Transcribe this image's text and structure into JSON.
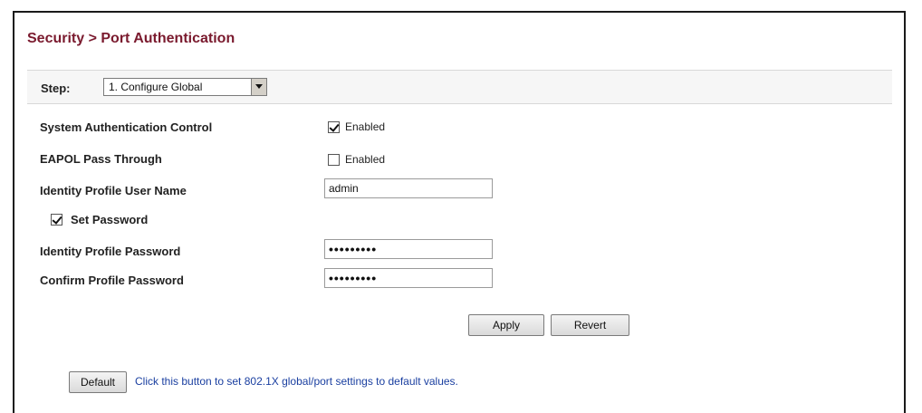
{
  "header": {
    "title": "Security > Port Authentication"
  },
  "step": {
    "label": "Step:",
    "selected": "1. Configure Global"
  },
  "form": {
    "system_auth_control": {
      "label": "System Authentication Control",
      "checkbox_label": "Enabled",
      "checked": true
    },
    "eapol_pass_through": {
      "label": "EAPOL Pass Through",
      "checkbox_label": "Enabled",
      "checked": false
    },
    "identity_profile_user_name": {
      "label": "Identity Profile User Name",
      "value": "admin"
    },
    "set_password": {
      "label": "Set Password",
      "checked": true
    },
    "identity_profile_password": {
      "label": "Identity Profile Password",
      "value": "•••••••••"
    },
    "confirm_profile_password": {
      "label": "Confirm Profile Password",
      "value": "•••••••••"
    }
  },
  "actions": {
    "apply_label": "Apply",
    "revert_label": "Revert"
  },
  "footer": {
    "default_label": "Default",
    "note": "Click this button to set 802.1X global/port settings to default values."
  }
}
